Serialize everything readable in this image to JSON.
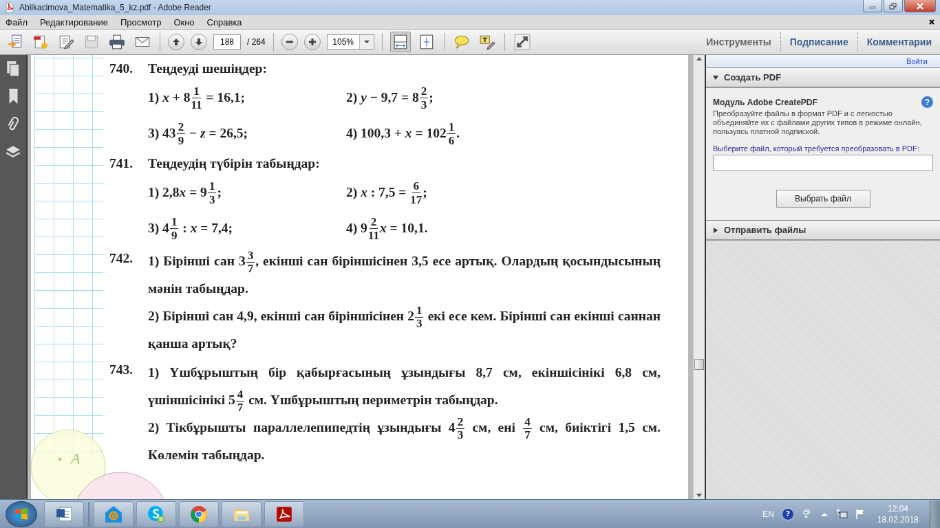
{
  "window": {
    "title": "Abilkacimova_Matematika_5_kz.pdf - Adobe Reader"
  },
  "menu": [
    "Файл",
    "Редактирование",
    "Просмотр",
    "Окно",
    "Справка"
  ],
  "toolbar": {
    "page": "188",
    "page_count": "/ 264",
    "zoom": "105%"
  },
  "panels": [
    "Инструменты",
    "Подписание",
    "Комментарии"
  ],
  "document": {
    "margin_label": "A",
    "problems": [
      {
        "kind": "equations",
        "number": "740.",
        "title": "Теңдеуді шешіңдер:",
        "items": [
          [
            {
              "kind": "text",
              "text": "1) "
            },
            {
              "kind": "var",
              "text": "x"
            },
            {
              "kind": "text",
              "text": " + 8"
            },
            {
              "kind": "frac",
              "num": "1",
              "den": "11"
            },
            {
              "kind": "text",
              "text": " = 16,1;"
            }
          ],
          [
            {
              "kind": "text",
              "text": "2) "
            },
            {
              "kind": "var",
              "text": "y"
            },
            {
              "kind": "text",
              "text": " − 9,7 = 8"
            },
            {
              "kind": "frac",
              "num": "2",
              "den": "3"
            },
            {
              "kind": "text",
              "text": ";"
            }
          ],
          [
            {
              "kind": "text",
              "text": "3) 43"
            },
            {
              "kind": "frac",
              "num": "2",
              "den": "9"
            },
            {
              "kind": "text",
              "text": " − "
            },
            {
              "kind": "var",
              "text": "z"
            },
            {
              "kind": "text",
              "text": " = 26,5;"
            }
          ],
          [
            {
              "kind": "text",
              "text": "4) 100,3 + "
            },
            {
              "kind": "var",
              "text": "x"
            },
            {
              "kind": "text",
              "text": " = 102"
            },
            {
              "kind": "frac",
              "num": "1",
              "den": "6"
            },
            {
              "kind": "text",
              "text": "."
            }
          ]
        ]
      },
      {
        "kind": "equations",
        "number": "741.",
        "title": "Теңдеудің түбірін табыңдар:",
        "items": [
          [
            {
              "kind": "text",
              "text": "1) 2,8"
            },
            {
              "kind": "var",
              "text": "x"
            },
            {
              "kind": "text",
              "text": " = 9"
            },
            {
              "kind": "frac",
              "num": "1",
              "den": "3"
            },
            {
              "kind": "text",
              "text": ";"
            }
          ],
          [
            {
              "kind": "text",
              "text": "2) "
            },
            {
              "kind": "var",
              "text": "x"
            },
            {
              "kind": "text",
              "text": " : 7,5 = "
            },
            {
              "kind": "frac",
              "num": "6",
              "den": "17"
            },
            {
              "kind": "text",
              "text": ";"
            }
          ],
          [
            {
              "kind": "text",
              "text": "3) 4"
            },
            {
              "kind": "frac",
              "num": "1",
              "den": "9"
            },
            {
              "kind": "text",
              "text": " : "
            },
            {
              "kind": "var",
              "text": "x"
            },
            {
              "kind": "text",
              "text": " = 7,4;"
            }
          ],
          [
            {
              "kind": "text",
              "text": "4) 9"
            },
            {
              "kind": "frac",
              "num": "2",
              "den": "11"
            },
            {
              "kind": "var",
              "text": "x"
            },
            {
              "kind": "text",
              "text": " = 10,1."
            }
          ]
        ]
      },
      {
        "kind": "text",
        "number": "742.",
        "paragraphs": [
          [
            {
              "kind": "text",
              "text": "1) Бірінші сан 3"
            },
            {
              "kind": "frac",
              "num": "3",
              "den": "7"
            },
            {
              "kind": "text",
              "text": ", екінші сан біріншісінен 3,5 есе артық. Олардың қосындысының мәнін табыңдар."
            }
          ],
          [
            {
              "kind": "text",
              "text": "2) Бірінші сан 4,9, екінші сан біріншісінен 2"
            },
            {
              "kind": "frac",
              "num": "1",
              "den": "3"
            },
            {
              "kind": "text",
              "text": " екі есе кем. Бірінші сан екінші саннан қанша артық?"
            }
          ]
        ]
      },
      {
        "kind": "text",
        "number": "743.",
        "paragraphs": [
          [
            {
              "kind": "text",
              "text": "1) Үшбұрыштың бір қабырғасының ұзындығы 8,7 см, екіншісінікі 6,8 см, үшіншісінікі 5"
            },
            {
              "kind": "frac",
              "num": "4",
              "den": "7"
            },
            {
              "kind": "text",
              "text": " см. Үшбұрыштың периметрін табыңдар."
            }
          ],
          [
            {
              "kind": "text",
              "text": "2) Тікбұрышты параллелепипедтің ұзындығы 4"
            },
            {
              "kind": "frac",
              "num": "2",
              "den": "3"
            },
            {
              "kind": "text",
              "text": " см, ені "
            },
            {
              "kind": "frac",
              "num": "4",
              "den": "7"
            },
            {
              "kind": "text",
              "text": " см, биіктігі 1,5 см. Көлемін табыңдар."
            }
          ]
        ]
      }
    ]
  },
  "right_pane": {
    "sign_in": "Войти",
    "sections": [
      {
        "title": "Создать PDF",
        "expanded": true,
        "module_title": "Модуль Adobe CreatePDF",
        "help": "?",
        "description": "Преобразуйте файлы в формат PDF и с легкостью объединяйте их с файлами других типов в режиме онлайн, пользуясь платной подпиской.",
        "file_label": "Выберите файл, который требуется преобразовать в PDF:",
        "button": "Выбрать файл"
      },
      {
        "title": "Отправить файлы",
        "expanded": false
      }
    ]
  },
  "taskbar": {
    "language": "EN",
    "help": "?",
    "time": "12:04",
    "date": "18.02.2018"
  }
}
